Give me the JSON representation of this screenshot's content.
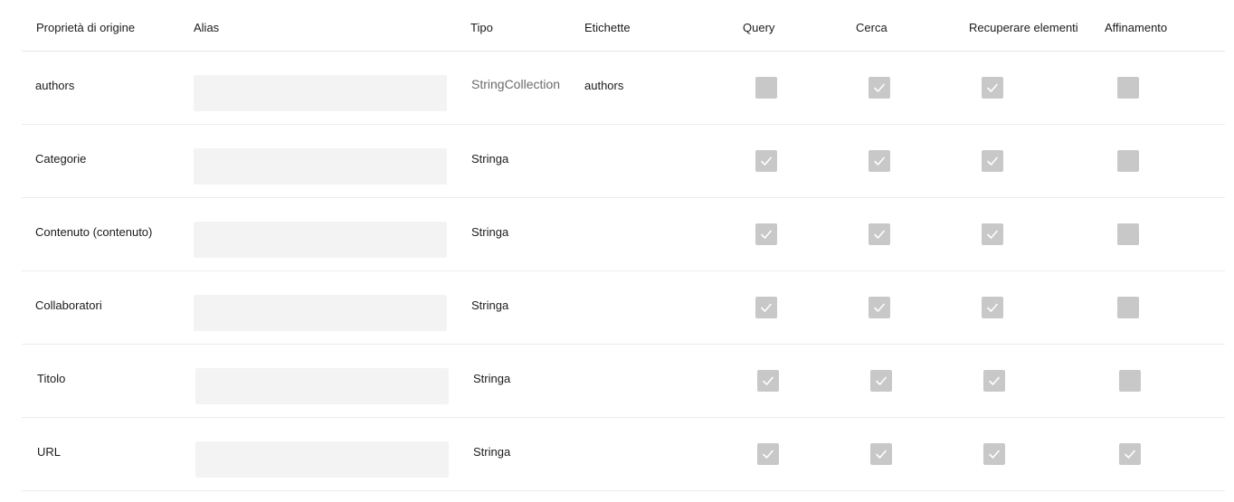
{
  "columns": {
    "source_property": "Proprietà di origine",
    "alias": "Alias",
    "type": "Tipo",
    "labels": "Etichette",
    "query": "Query",
    "search": "Cerca",
    "retrieve": "Recuperare elementi",
    "refine": "Affinamento"
  },
  "rows": [
    {
      "source": "authors",
      "alias": "",
      "type": "StringCollection",
      "labels": "authors",
      "query": false,
      "search": true,
      "retrieve": true,
      "refine": false
    },
    {
      "source": "Categorie",
      "alias": "",
      "type": "Stringa",
      "labels": "",
      "query": true,
      "search": true,
      "retrieve": true,
      "refine": false
    },
    {
      "source": "Contenuto (contenuto)",
      "alias": "",
      "type": "Stringa",
      "labels": "",
      "query": true,
      "search": true,
      "retrieve": true,
      "refine": false
    },
    {
      "source": "Collaboratori",
      "alias": "",
      "type": "Stringa",
      "labels": "",
      "query": true,
      "search": true,
      "retrieve": true,
      "refine": false
    },
    {
      "source": "Titolo",
      "alias": "",
      "type": "Stringa",
      "labels": "",
      "query": true,
      "search": true,
      "retrieve": true,
      "refine": false
    },
    {
      "source": "URL",
      "alias": "",
      "type": "Stringa",
      "labels": "",
      "query": true,
      "search": true,
      "retrieve": true,
      "refine": true
    }
  ],
  "colors": {
    "checkbox_fill": "#c8c8c8",
    "checkmark": "#ffffff",
    "input_bg": "#f3f3f3",
    "divider": "#ececec"
  }
}
